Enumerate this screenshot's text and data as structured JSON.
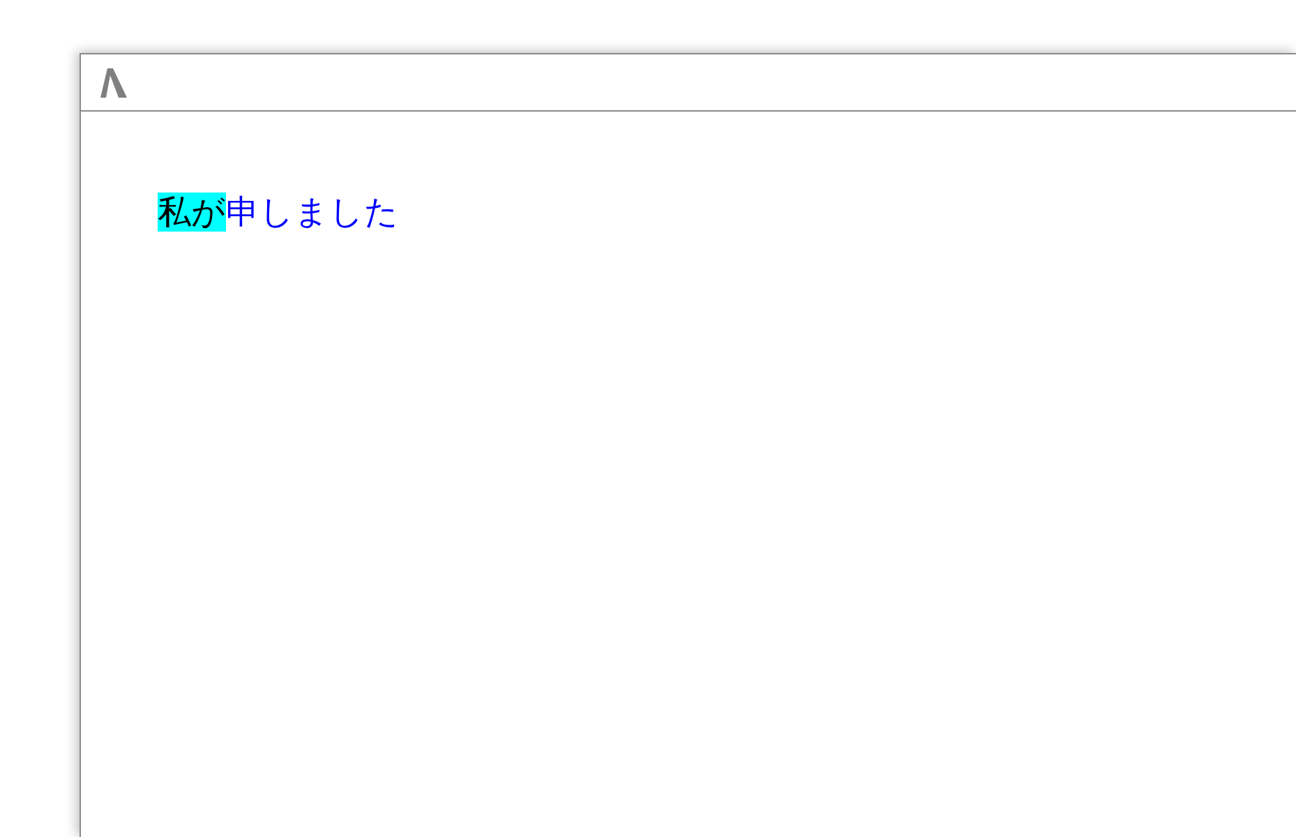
{
  "content": {
    "sentence": [
      {
        "text": "私が",
        "highlighted": true
      },
      {
        "text": "申しました",
        "highlighted": false
      }
    ]
  }
}
